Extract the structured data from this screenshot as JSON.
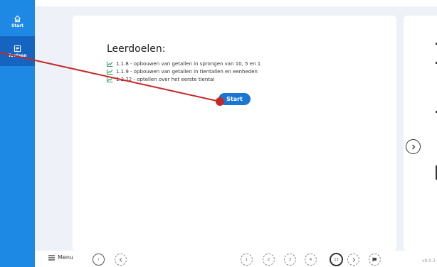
{
  "sidebar": {
    "items": [
      {
        "label": "Start",
        "icon": "home-icon"
      },
      {
        "label": "Toetsen",
        "icon": "test-icon"
      }
    ]
  },
  "main": {
    "title": "Leerdoelen:",
    "goals": [
      "1.1.8 - opbouwen van getallen in sprongen van 10, 5 en 1",
      "1.1.9 - opbouwen van getallen in tientallen en eenheden",
      "1.2.22 - optellen over het eerste tiental"
    ],
    "start_label": "Start"
  },
  "bottom": {
    "menu_label": "Menu",
    "info_label": "i",
    "pages": [
      "1",
      "2",
      "3",
      "4",
      "13"
    ],
    "version": "v9.0.3"
  },
  "colors": {
    "sidebar": "#1e88e5",
    "sidebar_active": "#1565c0",
    "start_button": "#1976d2",
    "pointer": "#c62828"
  }
}
